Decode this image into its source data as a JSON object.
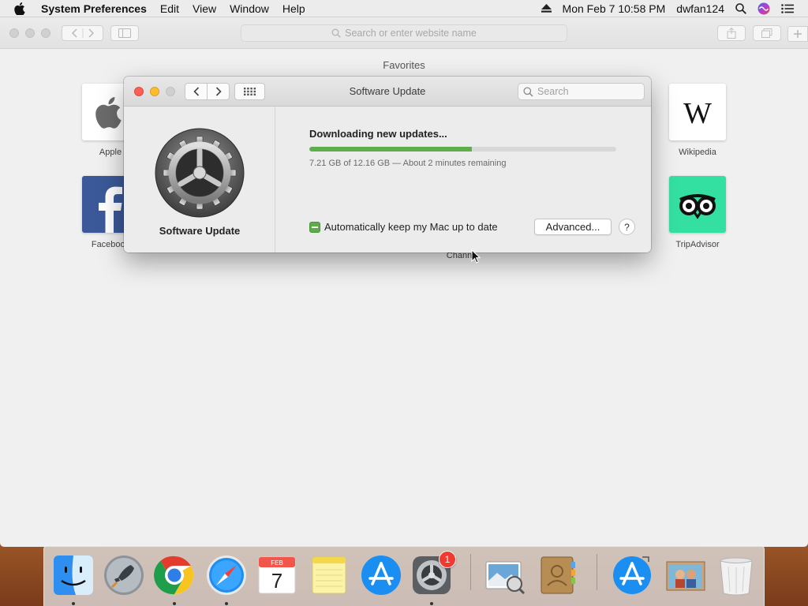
{
  "menubar": {
    "app_name": "System Preferences",
    "menus": [
      "Edit",
      "View",
      "Window",
      "Help"
    ],
    "datetime": "Mon Feb 7  10:58 PM",
    "user": "dwfan124"
  },
  "safari": {
    "address_placeholder": "Search or enter website name",
    "favorites_title": "Favorites",
    "favorites": [
      {
        "label": "Apple",
        "icon": "apple-logo-icon"
      },
      {
        "label": "Wikipedia",
        "icon": "wikipedia-icon"
      },
      {
        "label": "Facebook",
        "icon": "facebook-icon"
      },
      {
        "label": "TripAdvisor",
        "icon": "tripadvisor-icon"
      },
      {
        "label": "Chann",
        "icon": "none"
      }
    ]
  },
  "software_update": {
    "window_title": "Software Update",
    "search_placeholder": "Search",
    "pane_name": "Software Update",
    "status": "Downloading new updates...",
    "progress_fraction": 0.53,
    "progress_text": "7.21 GB of 12.16 GB — About 2 minutes remaining",
    "auto_update_label": "Automatically keep my Mac up to date",
    "auto_update_state": "mixed",
    "advanced_label": "Advanced...",
    "help_label": "?"
  },
  "dock": {
    "apps": [
      {
        "name": "Finder",
        "icon": "finder-icon",
        "running": true
      },
      {
        "name": "Launchpad",
        "icon": "launchpad-icon",
        "running": false
      },
      {
        "name": "Google Chrome",
        "icon": "chrome-icon",
        "running": true
      },
      {
        "name": "Safari",
        "icon": "safari-icon",
        "running": true
      },
      {
        "name": "Calendar",
        "icon": "calendar-icon",
        "running": false,
        "month": "FEB",
        "day": "7"
      },
      {
        "name": "Notes",
        "icon": "notes-icon",
        "running": false
      },
      {
        "name": "App Store",
        "icon": "app-store-icon",
        "running": false
      },
      {
        "name": "System Preferences",
        "icon": "system-preferences-icon",
        "running": true,
        "badge": "1"
      },
      {
        "name": "Preview",
        "icon": "preview-icon",
        "running": false
      },
      {
        "name": "Contacts",
        "icon": "contacts-icon",
        "running": false
      },
      {
        "name": "Install macOS",
        "icon": "app-store-download-icon",
        "running": false
      },
      {
        "name": "Photo",
        "icon": "photo-thumbnail-icon",
        "running": false
      },
      {
        "name": "Trash",
        "icon": "trash-icon",
        "running": false
      }
    ]
  },
  "colors": {
    "progress_fill": "#5fae4c",
    "close_red": "#fc5f57",
    "minimize_yellow": "#fdbc2e"
  }
}
